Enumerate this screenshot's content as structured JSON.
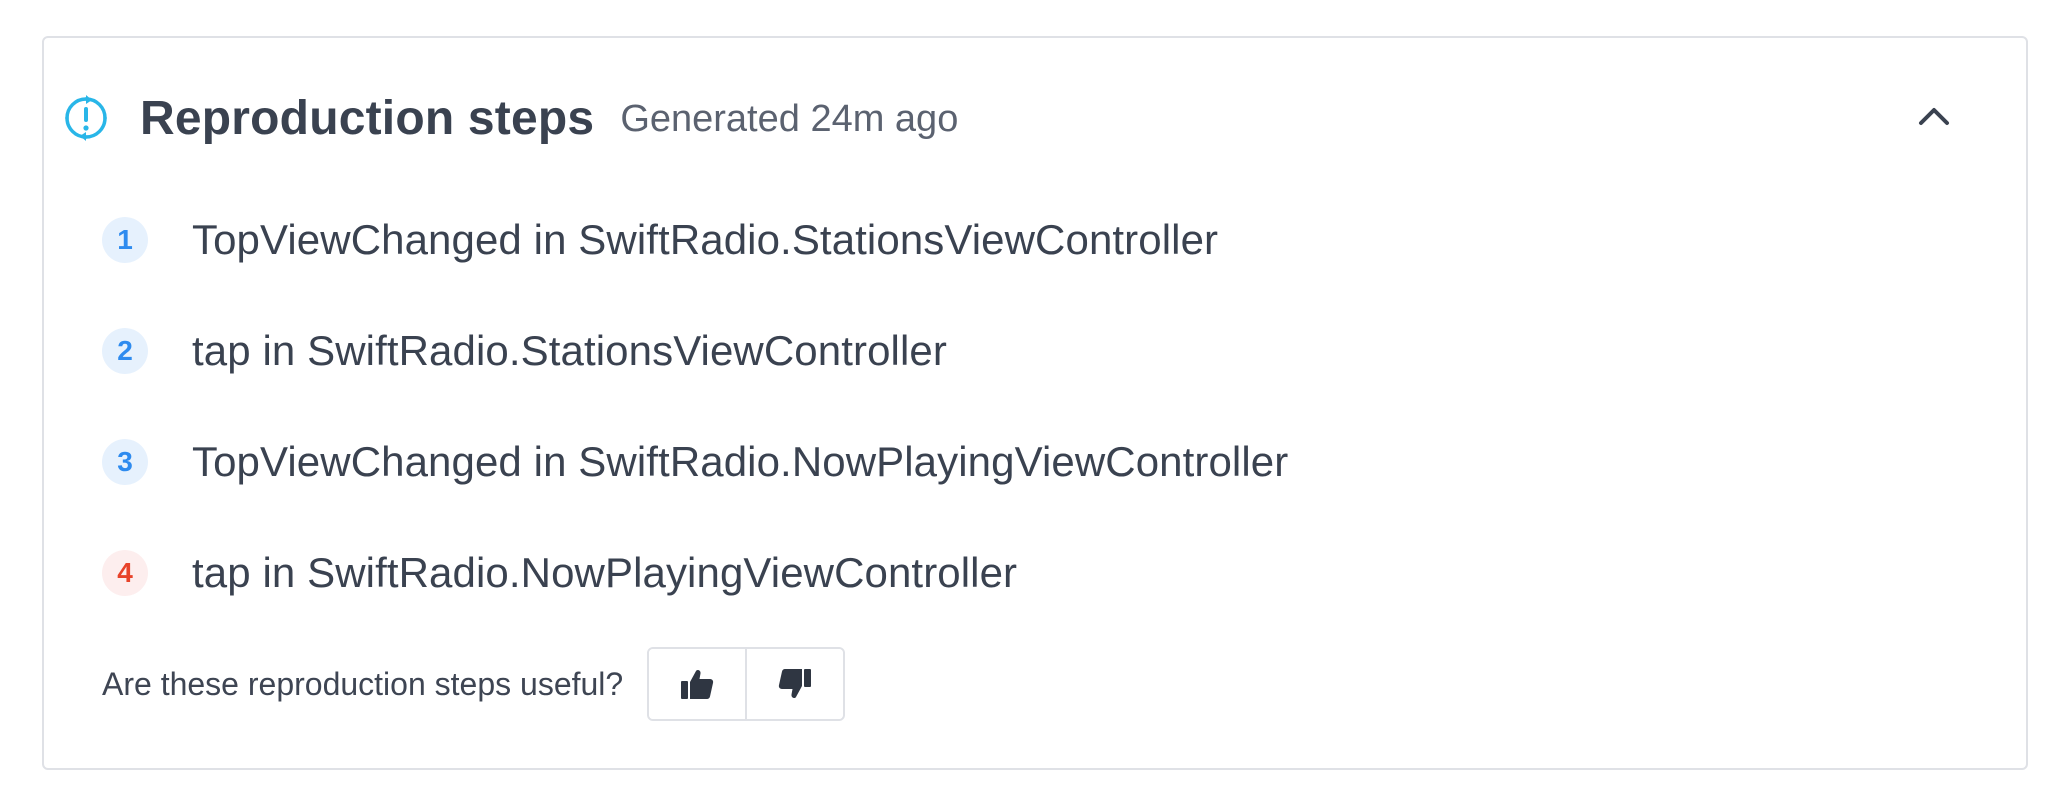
{
  "header": {
    "title": "Reproduction steps",
    "subtitle": "Generated 24m ago",
    "icon": "sync-alert-icon",
    "collapse_icon": "chevron-up-icon"
  },
  "steps": [
    {
      "number": "1",
      "text": "TopViewChanged in SwiftRadio.StationsViewController"
    },
    {
      "number": "2",
      "text": "tap in SwiftRadio.StationsViewController"
    },
    {
      "number": "3",
      "text": "TopViewChanged in SwiftRadio.NowPlayingViewController"
    },
    {
      "number": "4",
      "text": "tap in SwiftRadio.NowPlayingViewController"
    }
  ],
  "feedback": {
    "question": "Are these reproduction steps useful?",
    "thumbs_up_icon": "thumbs-up-icon",
    "thumbs_down_icon": "thumbs-down-icon"
  },
  "colors": {
    "accent": "#2e8bef",
    "icon_teal": "#29b6e8",
    "error": "#e8432a",
    "text": "#3a4250"
  }
}
